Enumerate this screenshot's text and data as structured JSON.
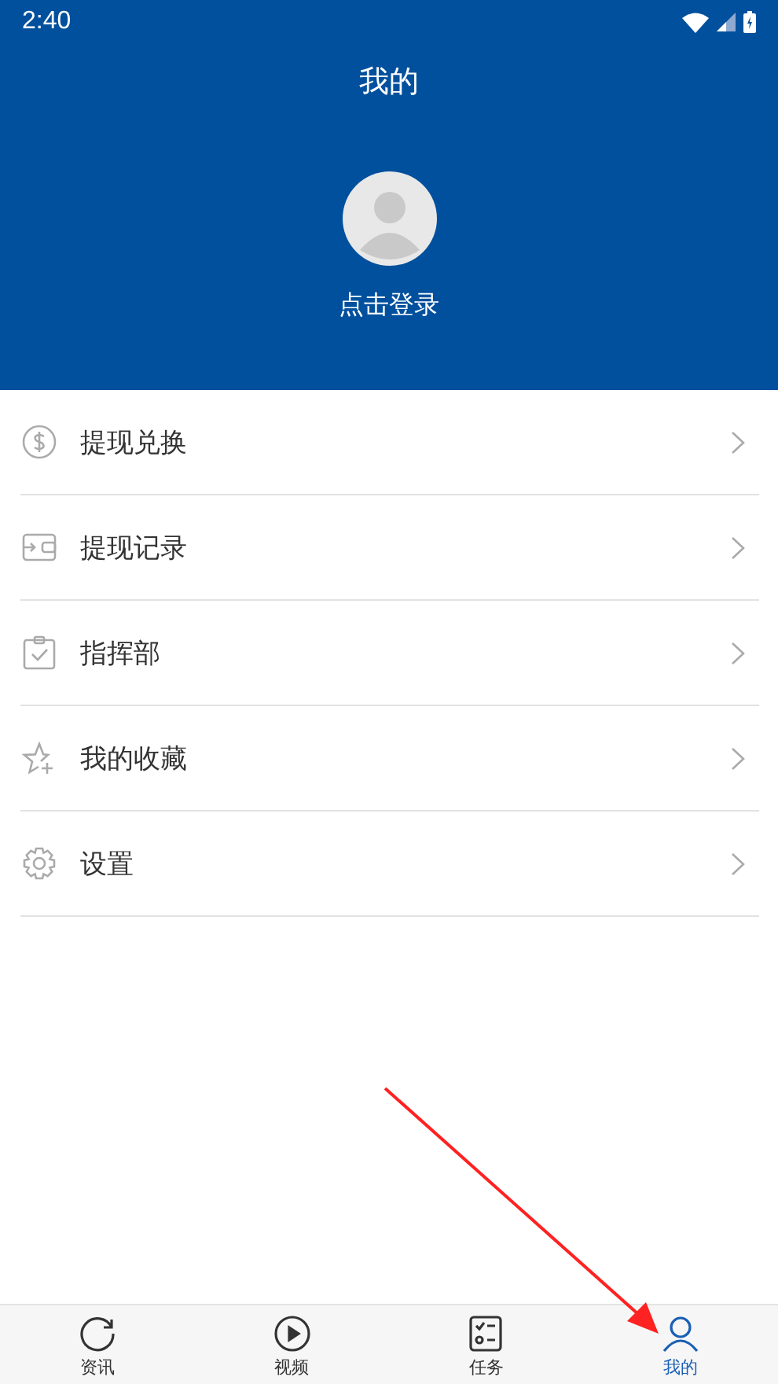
{
  "status_bar": {
    "time": "2:40"
  },
  "header": {
    "title": "我的",
    "login": "点击登录"
  },
  "menu": [
    {
      "kind": "dollar",
      "label": "提现兑换"
    },
    {
      "kind": "wallet",
      "label": "提现记录"
    },
    {
      "kind": "clipboard",
      "label": "指挥部"
    },
    {
      "kind": "star",
      "label": "我的收藏"
    },
    {
      "kind": "gear",
      "label": "设置"
    }
  ],
  "tabs": [
    {
      "kind": "refresh",
      "label": "资讯",
      "selected": false
    },
    {
      "kind": "play",
      "label": "视频",
      "selected": false
    },
    {
      "kind": "tasks",
      "label": "任务",
      "selected": false
    },
    {
      "kind": "user",
      "label": "我的",
      "selected": true
    }
  ]
}
